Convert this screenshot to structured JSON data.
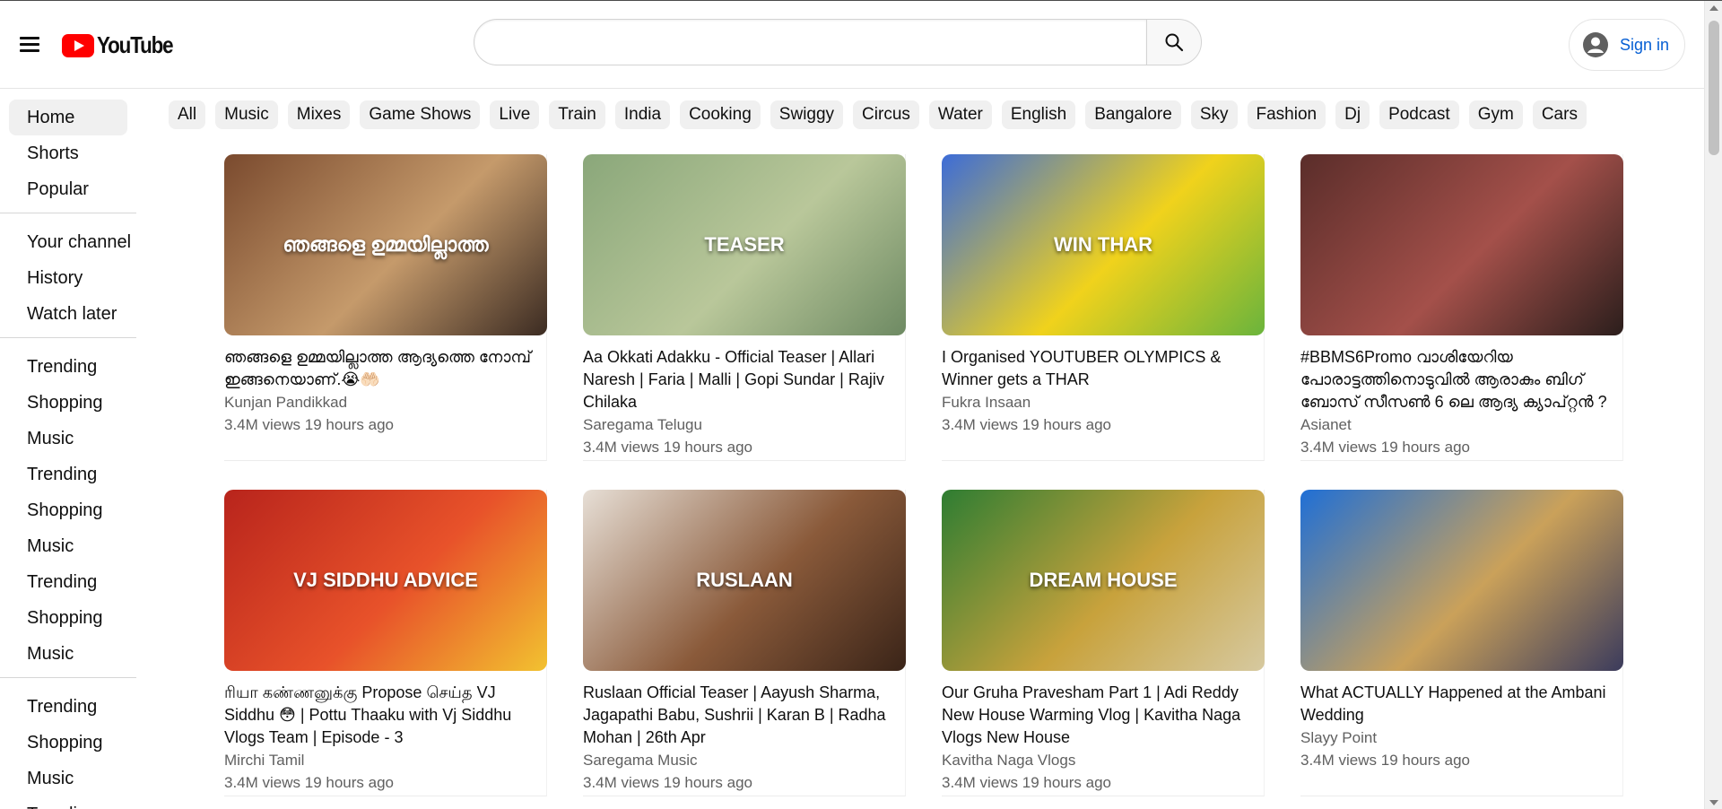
{
  "header": {
    "logo_text": "YouTube",
    "search_placeholder": "",
    "sign_in_label": "Sign in"
  },
  "sidebar": {
    "groups": [
      {
        "items": [
          "Home",
          "Shorts",
          "Popular"
        ]
      },
      {
        "items": [
          "Your channel",
          "History",
          "Watch later"
        ]
      },
      {
        "items": [
          "Trending",
          "Shopping",
          "Music",
          "Trending",
          "Shopping",
          "Music",
          "Trending",
          "Shopping",
          "Music"
        ]
      },
      {
        "items": [
          "Trending",
          "Shopping",
          "Music",
          "Trending"
        ]
      }
    ],
    "active_item": "Home"
  },
  "chips": [
    "All",
    "Music",
    "Mixes",
    "Game Shows",
    "Live",
    "Train",
    "India",
    "Cooking",
    "Swiggy",
    "Circus",
    "Water",
    "English",
    "Bangalore",
    "Sky",
    "Fashion",
    "Dj",
    "Podcast",
    "Gym",
    "Cars"
  ],
  "videos": [
    {
      "title": "ഞങ്ങളെ ഉമ്മയില്ലാത്ത ആദ്യത്തെ നോമ്പ് ഇങ്ങനെയാണ്.😭🤲🏻",
      "channel": "Kunjan Pandikkad",
      "meta": "3.4M views 19 hours ago",
      "thumb_colors": [
        "#7a4a2e",
        "#c59a6b",
        "#3b2b22"
      ],
      "thumb_caption": "ഞങ്ങളെ ഉമ്മയില്ലാത്ത"
    },
    {
      "title": "Aa Okkati Adakku - Official Teaser | Allari Naresh | Faria | Malli | Gopi Sundar | Rajiv Chilaka",
      "channel": "Saregama Telugu",
      "meta": "3.4M views 19 hours ago",
      "thumb_colors": [
        "#8aa77a",
        "#b9c79a",
        "#6e8a63"
      ],
      "thumb_caption": "TEASER"
    },
    {
      "title": "I Organised YOUTUBER OLYMPICS & Winner gets a THAR",
      "channel": "Fukra Insaan",
      "meta": "3.4M views 19 hours ago",
      "thumb_colors": [
        "#3c6cd8",
        "#f0d21c",
        "#6ab43c"
      ],
      "thumb_caption": "WIN THAR"
    },
    {
      "title": "#BBMS6Promo വാശിയേറിയ പോരാട്ടത്തിനൊടുവിൽ ആരാകും ബിഗ് ബോസ് സീസൺ 6 ലെ ആദ്യ ക്യാപ്റ്റൻ ?",
      "channel": "Asianet",
      "meta": "3.4M views 19 hours ago",
      "thumb_colors": [
        "#5a2d2a",
        "#a4504a",
        "#2b1e1c"
      ],
      "thumb_caption": ""
    },
    {
      "title": "ரியா கண்ணனுக்கு Propose செய்த VJ Siddhu 😳 | Pottu Thaaku with Vj Siddhu Vlogs Team | Episode - 3",
      "channel": "Mirchi Tamil",
      "meta": "3.4M views 19 hours ago",
      "thumb_colors": [
        "#b8241c",
        "#e8522a",
        "#f2c230"
      ],
      "thumb_caption": "VJ SIDDHU ADVICE"
    },
    {
      "title": "Ruslaan Official Teaser | Aayush Sharma, Jagapathi Babu, Sushrii | Karan B | Radha Mohan | 26th Apr",
      "channel": "Saregama Music",
      "meta": "3.4M views 19 hours ago",
      "thumb_colors": [
        "#e7dfd6",
        "#8a5a3a",
        "#3a2418"
      ],
      "thumb_caption": "RUSLAAN"
    },
    {
      "title": "Our Gruha Pravesham Part 1 | Adi Reddy New House Warming Vlog | Kavitha Naga Vlogs New House",
      "channel": "Kavitha Naga Vlogs",
      "meta": "3.4M views 19 hours ago",
      "thumb_colors": [
        "#2e7d32",
        "#c8a23c",
        "#d6c9a0"
      ],
      "thumb_caption": "DREAM HOUSE"
    },
    {
      "title": "What ACTUALLY Happened at the Ambani Wedding",
      "channel": "Slayy Point",
      "meta": "3.4M views 19 hours ago",
      "thumb_colors": [
        "#1f6fd6",
        "#caa15a",
        "#3b3b5c"
      ],
      "thumb_caption": ""
    }
  ],
  "colors": {
    "accent_red": "#ff0000",
    "link_blue": "#065fd4",
    "chip_bg": "#f0f0f0",
    "secondary_text": "#606060"
  }
}
